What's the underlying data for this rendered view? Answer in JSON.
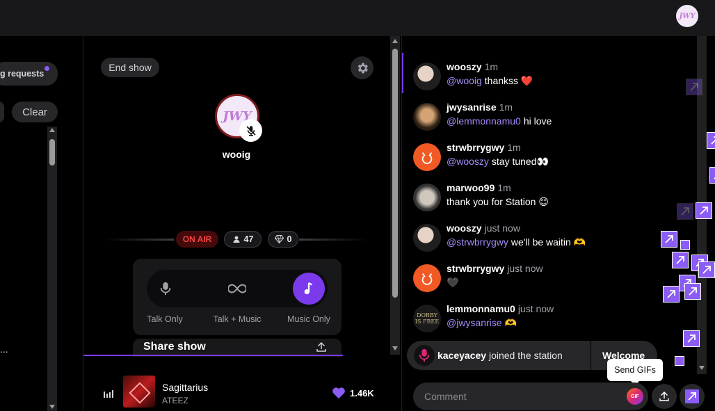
{
  "topbar": {
    "avatar_text": "JWY"
  },
  "left": {
    "requests_label": "g requests",
    "clear_label": "Clear",
    "ellipsis": "..."
  },
  "stage": {
    "end_show_label": "End show",
    "host_avatar_text": "JWY",
    "host_name": "wooig",
    "on_air_label": "ON AIR",
    "listeners": "47",
    "gems": "0",
    "modes": [
      {
        "label": "Talk Only",
        "icon": "mic-icon",
        "active": false
      },
      {
        "label": "Talk + Music",
        "icon": "infinity-icon",
        "active": false
      },
      {
        "label": "Music Only",
        "icon": "music-note-icon",
        "active": true
      }
    ],
    "share_label": "Share show"
  },
  "now_playing": {
    "title": "Sagittarius",
    "artist": "ATEEZ",
    "likes": "1.46K"
  },
  "chat": {
    "messages": [
      {
        "user": "wooszy",
        "time": "1m",
        "mention": "@wooig",
        "text": "thankss ❤️"
      },
      {
        "user": "jwysanrise",
        "time": "1m",
        "mention": "@lemmonnamu0",
        "text": "hi love"
      },
      {
        "user": "strwbrrygwy",
        "time": "1m",
        "mention": "@wooszy",
        "text": "stay tuned👀"
      },
      {
        "user": "marwoo99",
        "time": "1m",
        "mention": "",
        "text": "thank you for Station 😊"
      },
      {
        "user": "wooszy",
        "time": "just now",
        "mention": "@strwbrrygwy",
        "text": "we'll be waitin 🫶"
      },
      {
        "user": "strwbrrygwy",
        "time": "just now",
        "mention": "",
        "text": "🖤"
      },
      {
        "user": "lemmonnamu0",
        "time": "just now",
        "mention": "@jwysanrise",
        "text": "🫶"
      }
    ],
    "dobby_text": "DOBBY IS FREE",
    "join_user": "kaceyacey",
    "join_text": "joined the station",
    "welcome_label": "Welcome",
    "tooltip": "Send GIFs",
    "comment_placeholder": "Comment",
    "gif_label": "GIF"
  },
  "colors": {
    "accent": "#7c3aed",
    "on_air": "#ef4444",
    "panel": "#27272a"
  }
}
